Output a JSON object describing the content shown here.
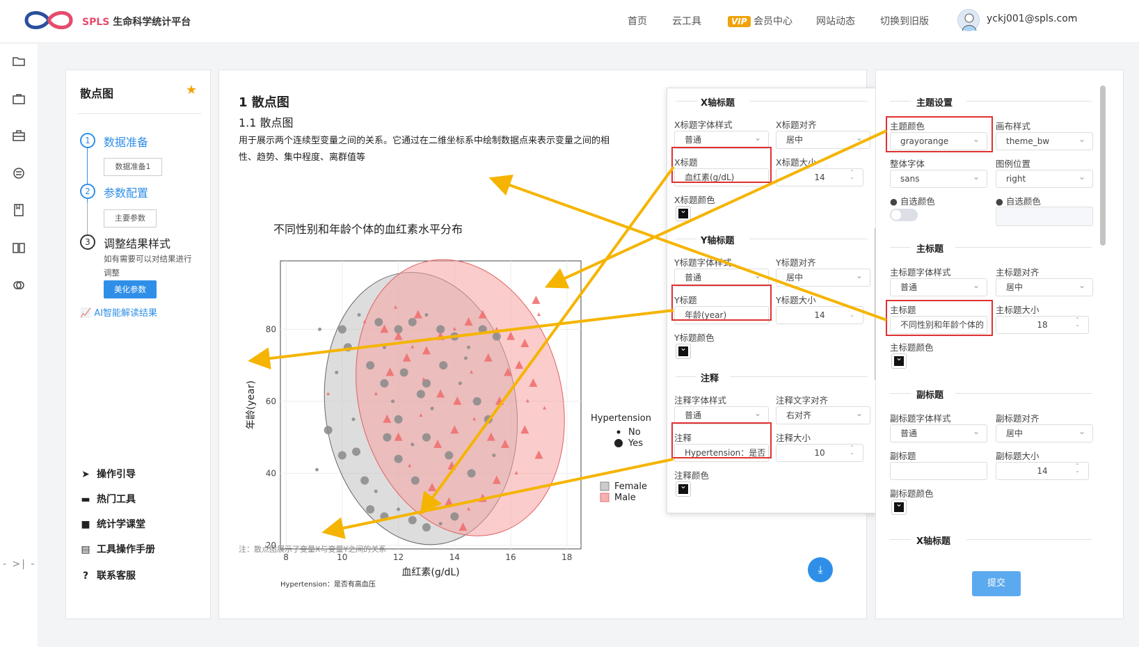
{
  "header": {
    "brand": "SPLS",
    "brand_sub": "生命科学统计平台",
    "nav": [
      "首页",
      "云工具",
      "会员中心",
      "网站动态",
      "切换到旧版"
    ],
    "vip": "VIP",
    "user": "yckj001@spls.com"
  },
  "left": {
    "title": "散点图",
    "steps": [
      {
        "num": "1",
        "label": "数据准备",
        "btn": "数据准备1"
      },
      {
        "num": "2",
        "label": "参数配置",
        "btn": "主要参数"
      },
      {
        "num": "3",
        "label": "调整结果样式",
        "desc1": "如有需要可以对结果进行",
        "desc2": "调整",
        "btn": "美化参数"
      }
    ],
    "ai": "AI智能解读结果",
    "menu": [
      "操作引导",
      "热门工具",
      "统计学课堂",
      "工具操作手册",
      "联系客服"
    ]
  },
  "main": {
    "h1": "1 散点图",
    "h2": "1.1 散点图",
    "desc1": "用于展示两个连续型变量之间的关系。它通过在二维坐标系中绘制数据点来表示变量之间的相",
    "desc2": "性、趋势、集中程度、离群值等",
    "note": "注：散点图展示了变量X与变量Y之间的关系"
  },
  "chart_data": {
    "type": "scatter",
    "title": "不同性别和年龄个体的血红素水平分布",
    "xlabel": "血红素(g/dL)",
    "ylabel": "年龄(year)",
    "xticks": [
      "8",
      "10",
      "12",
      "14",
      "16",
      "18"
    ],
    "yticks": [
      "20",
      "40",
      "60",
      "80"
    ],
    "xlim": [
      7.8,
      18.5
    ],
    "ylim": [
      19,
      99
    ],
    "legend_size_title": "Hypertension",
    "legend_size": [
      "No",
      "Yes"
    ],
    "legend_color": [
      "Female",
      "Male"
    ],
    "caption": "Hypertension：是否有高血压",
    "series": [
      {
        "name": "Female",
        "color": "#8a8a8a",
        "points": [
          [
            9.2,
            80
          ],
          [
            10,
            80
          ],
          [
            10.2,
            75
          ],
          [
            9.8,
            68
          ],
          [
            9.5,
            52
          ],
          [
            10,
            45
          ],
          [
            9.1,
            41
          ],
          [
            10.5,
            46
          ],
          [
            10.8,
            38
          ],
          [
            11.2,
            35
          ],
          [
            11,
            30
          ],
          [
            11.5,
            28
          ],
          [
            12,
            30
          ],
          [
            12.5,
            27
          ],
          [
            13,
            25
          ],
          [
            13.5,
            26
          ],
          [
            14,
            28
          ],
          [
            12,
            44
          ],
          [
            12.5,
            48
          ],
          [
            13,
            50
          ],
          [
            12,
            55
          ],
          [
            11.8,
            60
          ],
          [
            11.5,
            65
          ],
          [
            11,
            70
          ],
          [
            11.5,
            75
          ],
          [
            12,
            80
          ],
          [
            12.5,
            82
          ],
          [
            13,
            84
          ],
          [
            13.5,
            80
          ],
          [
            14,
            78
          ],
          [
            14.5,
            75
          ],
          [
            15,
            80
          ],
          [
            15.5,
            78
          ],
          [
            14.2,
            65
          ],
          [
            14.8,
            60
          ],
          [
            15.2,
            55
          ],
          [
            13.2,
            58
          ],
          [
            12.8,
            62
          ],
          [
            13.6,
            70
          ],
          [
            14.4,
            72
          ],
          [
            12.2,
            68
          ],
          [
            11.3,
            82
          ],
          [
            10.6,
            84
          ],
          [
            13.8,
            45
          ],
          [
            14.6,
            40
          ],
          [
            15.4,
            45
          ],
          [
            12.6,
            38
          ],
          [
            11.6,
            50
          ],
          [
            10.4,
            55
          ],
          [
            13,
            65
          ]
        ]
      },
      {
        "name": "Male",
        "color": "#f07070",
        "points": [
          [
            10.8,
            82
          ],
          [
            11.5,
            80
          ],
          [
            12,
            78
          ],
          [
            12.5,
            75
          ],
          [
            13,
            74
          ],
          [
            13.5,
            78
          ],
          [
            14,
            80
          ],
          [
            14.5,
            82
          ],
          [
            15,
            84
          ],
          [
            15.5,
            80
          ],
          [
            16,
            78
          ],
          [
            16.5,
            76
          ],
          [
            17,
            84
          ],
          [
            16.3,
            70
          ],
          [
            16.8,
            65
          ],
          [
            17.2,
            58
          ],
          [
            16.5,
            52
          ],
          [
            17,
            45
          ],
          [
            16.2,
            40
          ],
          [
            15.5,
            38
          ],
          [
            15,
            33
          ],
          [
            14.5,
            30
          ],
          [
            13.8,
            32
          ],
          [
            13.2,
            36
          ],
          [
            12.4,
            42
          ],
          [
            12,
            50
          ],
          [
            11.6,
            55
          ],
          [
            11.2,
            62
          ],
          [
            11.7,
            68
          ],
          [
            12.3,
            72
          ],
          [
            12.9,
            66
          ],
          [
            13.5,
            62
          ],
          [
            14.1,
            60
          ],
          [
            14.7,
            55
          ],
          [
            15.3,
            50
          ],
          [
            15.8,
            48
          ],
          [
            16.6,
            60
          ],
          [
            15.9,
            68
          ],
          [
            15.2,
            72
          ],
          [
            14.6,
            68
          ],
          [
            14,
            52
          ],
          [
            13.4,
            48
          ],
          [
            12.8,
            56
          ],
          [
            13.9,
            42
          ],
          [
            15.6,
            60
          ],
          [
            9.5,
            62
          ],
          [
            14.3,
            25
          ],
          [
            12.7,
            84
          ],
          [
            11.9,
            86
          ],
          [
            16.9,
            88
          ]
        ]
      }
    ]
  },
  "ellipses": {
    "female_label": "Female",
    "male_label": "Male"
  },
  "x_axis_panel": {
    "title": "X轴标题",
    "font_style_label": "X标题字体样式",
    "font_style": "普通",
    "align_label": "X标题对齐",
    "align": "居中",
    "text_label": "X标题",
    "text": "血红素(g/dL)",
    "size_label": "X标题大小",
    "size": "14",
    "color_label": "X标题颜色"
  },
  "y_axis_panel": {
    "title": "Y轴标题",
    "font_style_label": "Y标题字体样式",
    "font_style": "普通",
    "align_label": "Y标题对齐",
    "align": "居中",
    "text_label": "Y标题",
    "text": "年龄(year)",
    "size_label": "Y标题大小",
    "size": "14",
    "color_label": "Y标题颜色"
  },
  "note_panel": {
    "title": "注释",
    "font_style_label": "注释字体样式",
    "font_style": "普通",
    "align_label": "注释文字对齐",
    "align": "右对齐",
    "text_label": "注释",
    "text": "Hypertension：是否",
    "size_label": "注释大小",
    "size": "10",
    "color_label": "注释颜色"
  },
  "theme_panel": {
    "title": "主题设置",
    "theme_color_label": "主题颜色",
    "theme_color": "grayorange",
    "canvas_label": "画布样式",
    "canvas": "theme_bw",
    "font_label": "整体字体",
    "font": "sans",
    "legend_pos_label": "图例位置",
    "legend_pos": "right",
    "custom_color_label": "自选颜色",
    "custom_color_label2": "自选颜色"
  },
  "main_title_panel": {
    "title": "主标题",
    "font_style_label": "主标题字体样式",
    "font_style": "普通",
    "align_label": "主标题对齐",
    "align": "居中",
    "text_label": "主标题",
    "text": "不同性别和年龄个体的",
    "size_label": "主标题大小",
    "size": "18",
    "color_label": "主标题颜色"
  },
  "sub_title_panel": {
    "title": "副标题",
    "font_style_label": "副标题字体样式",
    "font_style": "普通",
    "align_label": "副标题对齐",
    "align": "居中",
    "text_label": "副标题",
    "text": "",
    "size_label": "副标题大小",
    "size": "14",
    "color_label": "副标题颜色"
  },
  "xaxis_next_title": "X轴标题",
  "submit": "提交"
}
